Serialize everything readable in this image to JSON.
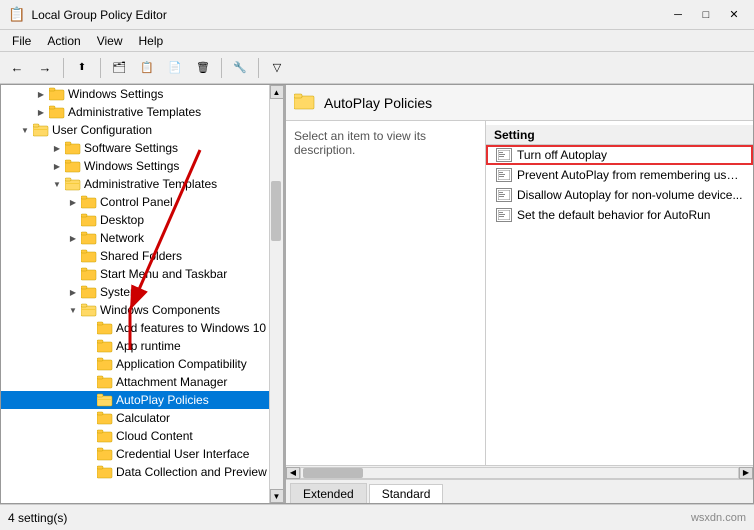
{
  "window": {
    "title": "Local Group Policy Editor",
    "icon": "📋"
  },
  "menu": {
    "items": [
      "File",
      "Action",
      "View",
      "Help"
    ]
  },
  "toolbar": {
    "buttons": [
      "←",
      "→",
      "⬆",
      "📁",
      "📋",
      "📄",
      "✂",
      "❌",
      "🔧",
      "🔍"
    ]
  },
  "tree": {
    "items": [
      {
        "id": "win-settings-1",
        "label": "Windows Settings",
        "indent": 2,
        "type": "folder",
        "expanded": false,
        "expander": "▶"
      },
      {
        "id": "admin-templates-1",
        "label": "Administrative Templates",
        "indent": 2,
        "type": "folder",
        "expanded": false,
        "expander": "▶"
      },
      {
        "id": "user-config",
        "label": "User Configuration",
        "indent": 1,
        "type": "folder-open",
        "expanded": true,
        "expander": "▼"
      },
      {
        "id": "software-settings",
        "label": "Software Settings",
        "indent": 3,
        "type": "folder",
        "expanded": false,
        "expander": "▶"
      },
      {
        "id": "win-settings-2",
        "label": "Windows Settings",
        "indent": 3,
        "type": "folder",
        "expanded": false,
        "expander": "▶"
      },
      {
        "id": "admin-templates-2",
        "label": "Administrative Templates",
        "indent": 3,
        "type": "folder",
        "expanded": true,
        "expander": "▼"
      },
      {
        "id": "control-panel",
        "label": "Control Panel",
        "indent": 4,
        "type": "folder",
        "expanded": false,
        "expander": "▶"
      },
      {
        "id": "desktop",
        "label": "Desktop",
        "indent": 4,
        "type": "folder",
        "expanded": false,
        "expander": ""
      },
      {
        "id": "network",
        "label": "Network",
        "indent": 4,
        "type": "folder",
        "expanded": false,
        "expander": "▶"
      },
      {
        "id": "shared-folders",
        "label": "Shared Folders",
        "indent": 4,
        "type": "folder",
        "expanded": false,
        "expander": ""
      },
      {
        "id": "start-menu",
        "label": "Start Menu and Taskbar",
        "indent": 4,
        "type": "folder",
        "expanded": false,
        "expander": ""
      },
      {
        "id": "system",
        "label": "System",
        "indent": 4,
        "type": "folder",
        "expanded": false,
        "expander": "▶"
      },
      {
        "id": "win-components",
        "label": "Windows Components",
        "indent": 4,
        "type": "folder",
        "expanded": true,
        "expander": "▼"
      },
      {
        "id": "add-features",
        "label": "Add features to Windows 10",
        "indent": 5,
        "type": "folder",
        "expanded": false,
        "expander": ""
      },
      {
        "id": "app-runtime",
        "label": "App runtime",
        "indent": 5,
        "type": "folder",
        "expanded": false,
        "expander": ""
      },
      {
        "id": "app-compat",
        "label": "Application Compatibility",
        "indent": 5,
        "type": "folder",
        "expanded": false,
        "expander": ""
      },
      {
        "id": "attach-mgr",
        "label": "Attachment Manager",
        "indent": 5,
        "type": "folder",
        "expanded": false,
        "expander": ""
      },
      {
        "id": "autoplay",
        "label": "AutoPlay Policies",
        "indent": 5,
        "type": "folder-open",
        "expanded": false,
        "expander": "",
        "selected": true
      },
      {
        "id": "calculator",
        "label": "Calculator",
        "indent": 5,
        "type": "folder",
        "expanded": false,
        "expander": ""
      },
      {
        "id": "cloud-content",
        "label": "Cloud Content",
        "indent": 5,
        "type": "folder",
        "expanded": false,
        "expander": ""
      },
      {
        "id": "cred-ui",
        "label": "Credential User Interface",
        "indent": 5,
        "type": "folder",
        "expanded": false,
        "expander": ""
      },
      {
        "id": "data-collection",
        "label": "Data Collection and Preview Buil...",
        "indent": 5,
        "type": "folder",
        "expanded": false,
        "expander": ""
      }
    ]
  },
  "right_panel": {
    "header_title": "AutoPlay Policies",
    "header_icon": "📁",
    "description_text": "Select an item to view its description.",
    "settings_header": "Setting",
    "settings": [
      {
        "id": "turn-off-autoplay",
        "label": "Turn off Autoplay",
        "highlighted": true
      },
      {
        "id": "prevent-autoplay",
        "label": "Prevent AutoPlay from remembering user..."
      },
      {
        "id": "disallow-autoplay",
        "label": "Disallow Autoplay for non-volume device..."
      },
      {
        "id": "set-default",
        "label": "Set the default behavior for AutoRun"
      }
    ]
  },
  "tabs": [
    {
      "label": "Extended",
      "active": false
    },
    {
      "label": "Standard",
      "active": true
    }
  ],
  "status_bar": {
    "text": "4 setting(s)",
    "watermark": "wsxdn.com"
  },
  "colors": {
    "selected_bg": "#0078d7",
    "highlight_border": "#e63031",
    "folder_yellow": "#ffc83d"
  }
}
